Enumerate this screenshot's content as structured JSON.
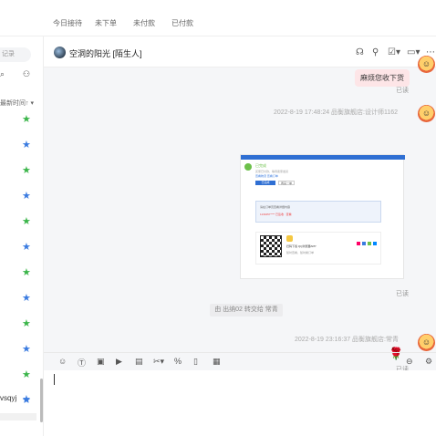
{
  "tabs": [
    "今日接待",
    "未下单",
    "未付款",
    "已付款"
  ],
  "sidebar": {
    "search_placeholder": "记录",
    "sort_label": "最新时间↑ ▾",
    "stars": [
      "green",
      "blue",
      "green",
      "blue",
      "green",
      "blue",
      "green",
      "blue",
      "green",
      "blue",
      "green",
      "blue",
      "green",
      "blue"
    ],
    "partial_name": "vsqyj",
    "icons": [
      "search-person-icon",
      "share-icon",
      "star-icon"
    ]
  },
  "chat": {
    "title": "空洞的阳光 [陌生人]",
    "header_icons": [
      "headset-icon",
      "person-icon",
      "checkbox-dropdown-icon",
      "video-dropdown-icon",
      "more-icon"
    ],
    "messages": {
      "m1_text": "麻烦您收下货",
      "m1_status": "已读",
      "m2_meta": "2022-8-19 17:48:24   品衡旗舰店:设计师1162",
      "m2_status": "已读",
      "sys_text": "由 出纳02 转交给 常青",
      "m3_meta": "2022-8-19 23:16:37   品衡旗舰店:常青",
      "m3_emoji": "🌹",
      "m3_status": "已读"
    },
    "card": {
      "status": "已完成",
      "line1": "买家已付款，等待卖家发货",
      "line2": "查看物流  查看订单",
      "btn1": "已完成",
      "btn2": "再来一单",
      "section1": "请在订单页查看详细内容",
      "addr": "1139457****   已签收 · 查看",
      "qr_title": "扫码下载 QQ浏览器APP",
      "qr_sub": "随时查看，随时看订单"
    }
  },
  "toolbar": [
    "emoji-icon",
    "text-icon",
    "image-icon",
    "video-icon",
    "file-icon",
    "scissors-icon",
    "discount-icon",
    "order-icon",
    "invoice-icon"
  ],
  "toolbar_right": [
    "send-history-icon",
    "settings-icon"
  ]
}
